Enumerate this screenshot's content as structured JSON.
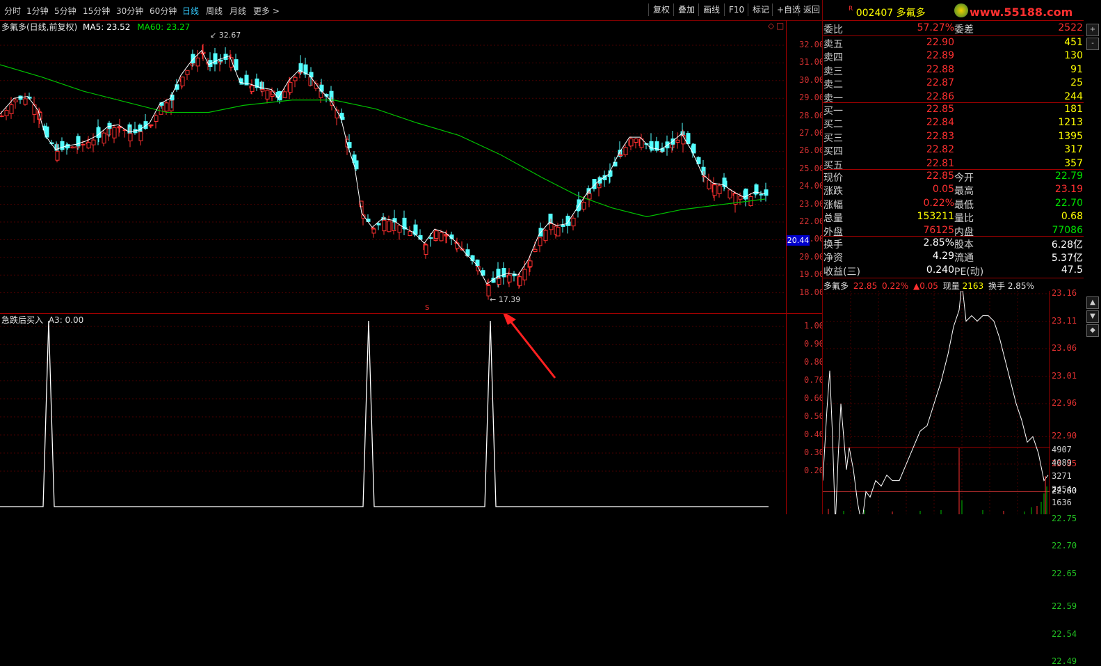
{
  "toolbar": {
    "periods": [
      "分时",
      "1分钟",
      "5分钟",
      "15分钟",
      "30分钟",
      "60分钟",
      "日线",
      "周线",
      "月线",
      "更多 >"
    ],
    "active_period": "日线",
    "buttons": [
      "复权",
      "叠加",
      "画线",
      "F10",
      "标记",
      "+自选",
      "返回"
    ]
  },
  "kline": {
    "header_name": "多氟多(日线,前复权)",
    "ma5_label": "MA5: 23.52",
    "ma60_label": "MA60: 23.27",
    "high_marker": "32.67",
    "low_marker": "17.39",
    "signal_mark": "S",
    "current_price_tag": "20.44",
    "yaxis": [
      "32.00",
      "31.00",
      "30.00",
      "29.00",
      "28.00",
      "27.00",
      "26.00",
      "25.00",
      "24.00",
      "23.00",
      "22.00",
      "21.00",
      "20.00",
      "19.00",
      "18.00"
    ],
    "colors": {
      "up": "#ff3030",
      "down": "#54ffff",
      "ma5": "#ffffff",
      "ma60": "#00c000"
    }
  },
  "indicator": {
    "title": "急跌后买入",
    "a3_label": "A3: 0.00",
    "yaxis": [
      "1.00",
      "0.90",
      "0.80",
      "0.70",
      "0.60",
      "0.50",
      "0.40",
      "0.30",
      "0.20"
    ]
  },
  "quote": {
    "stock_code": "002407",
    "stock_name": "多氟多",
    "logo_text": "www.55188.com",
    "weibi_label": "委比",
    "weibi": "57.27%",
    "weicha_label": "委差",
    "weicha": "2522",
    "asks": [
      {
        "label": "卖五",
        "price": "22.90",
        "vol": "451"
      },
      {
        "label": "卖四",
        "price": "22.89",
        "vol": "130"
      },
      {
        "label": "卖三",
        "price": "22.88",
        "vol": "91"
      },
      {
        "label": "卖二",
        "price": "22.87",
        "vol": "25"
      },
      {
        "label": "卖一",
        "price": "22.86",
        "vol": "244"
      }
    ],
    "bids": [
      {
        "label": "买一",
        "price": "22.85",
        "vol": "181"
      },
      {
        "label": "买二",
        "price": "22.84",
        "vol": "1213"
      },
      {
        "label": "买三",
        "price": "22.83",
        "vol": "1395"
      },
      {
        "label": "买四",
        "price": "22.82",
        "vol": "317"
      },
      {
        "label": "买五",
        "price": "22.81",
        "vol": "357"
      }
    ],
    "stats": [
      {
        "l1": "现价",
        "v1": "22.85",
        "l2": "今开",
        "v2": "22.79"
      },
      {
        "l1": "涨跌",
        "v1": "0.05",
        "l2": "最高",
        "v2": "23.19"
      },
      {
        "l1": "涨幅",
        "v1": "0.22%",
        "l2": "最低",
        "v2": "22.70"
      },
      {
        "l1": "总量",
        "v1": "153211",
        "l2": "量比",
        "v2": "0.68"
      },
      {
        "l1": "外盘",
        "v1": "76125",
        "l2": "内盘",
        "v2": "77086"
      }
    ],
    "fund": [
      {
        "l1": "换手",
        "v1": "2.85%",
        "l2": "股本",
        "v2": "6.28亿"
      },
      {
        "l1": "净资",
        "v1": "4.29",
        "l2": "流通",
        "v2": "5.37亿"
      },
      {
        "l1": "收益(三)",
        "v1": "0.240",
        "l2": "PE(动)",
        "v2": "47.5"
      }
    ]
  },
  "intraday": {
    "name": "多氟多",
    "price": "22.85",
    "pct": "0.22%",
    "chg": "▲0.05",
    "xianliang_label": "现量",
    "xianliang": "2163",
    "huanshou_label": "换手",
    "huanshou": "2.85%",
    "yaxis": [
      "23.16",
      "23.11",
      "23.06",
      "23.01",
      "22.96",
      "22.90",
      "22.85",
      "22.80",
      "22.75",
      "22.70",
      "22.65",
      "22.59",
      "22.54",
      "22.49"
    ],
    "vol_axis": [
      "4907",
      "4089",
      "3271",
      "2454",
      "1636"
    ],
    "side_buttons": [
      "+",
      "-",
      "▲",
      "▼",
      "◆"
    ]
  }
}
